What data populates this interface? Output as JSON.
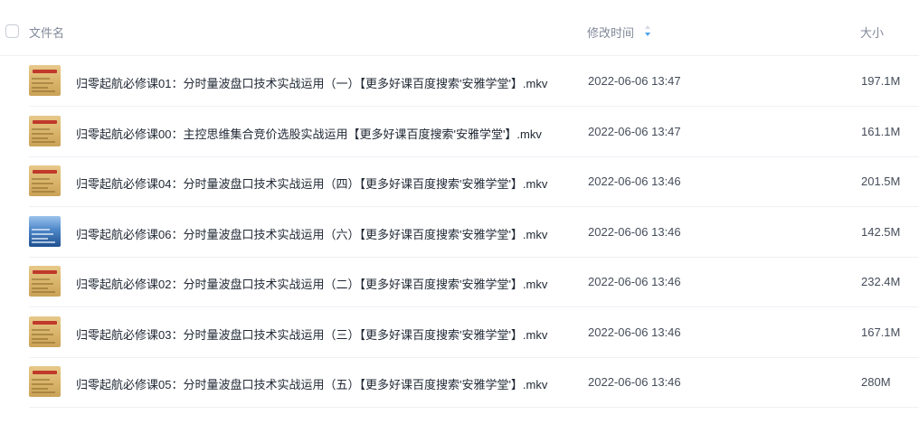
{
  "header": {
    "name_label": "文件名",
    "time_label": "修改时间",
    "size_label": "大小",
    "sort_icon": "sort-icon"
  },
  "files": [
    {
      "name": "归零起航必修课01：分时量波盘口技术实战运用（一）【更多好课百度搜索'安雅学堂'】.mkv",
      "modified": "2022-06-06 13:47",
      "size": "197.1M",
      "thumb": "gold"
    },
    {
      "name": "归零起航必修课00：主控思维集合竞价选股实战运用【更多好课百度搜索'安雅学堂'】.mkv",
      "modified": "2022-06-06 13:47",
      "size": "161.1M",
      "thumb": "gold"
    },
    {
      "name": "归零起航必修课04：分时量波盘口技术实战运用（四）【更多好课百度搜索'安雅学堂'】.mkv",
      "modified": "2022-06-06 13:46",
      "size": "201.5M",
      "thumb": "gold"
    },
    {
      "name": "归零起航必修课06：分时量波盘口技术实战运用（六）【更多好课百度搜索'安雅学堂'】.mkv",
      "modified": "2022-06-06 13:46",
      "size": "142.5M",
      "thumb": "blue"
    },
    {
      "name": "归零起航必修课02：分时量波盘口技术实战运用（二）【更多好课百度搜索'安雅学堂'】.mkv",
      "modified": "2022-06-06 13:46",
      "size": "232.4M",
      "thumb": "gold"
    },
    {
      "name": "归零起航必修课03：分时量波盘口技术实战运用（三）【更多好课百度搜索'安雅学堂'】.mkv",
      "modified": "2022-06-06 13:46",
      "size": "167.1M",
      "thumb": "gold"
    },
    {
      "name": "归零起航必修课05：分时量波盘口技术实战运用（五）【更多好课百度搜索'安雅学堂'】.mkv",
      "modified": "2022-06-06 13:46",
      "size": "280M",
      "thumb": "gold"
    }
  ]
}
